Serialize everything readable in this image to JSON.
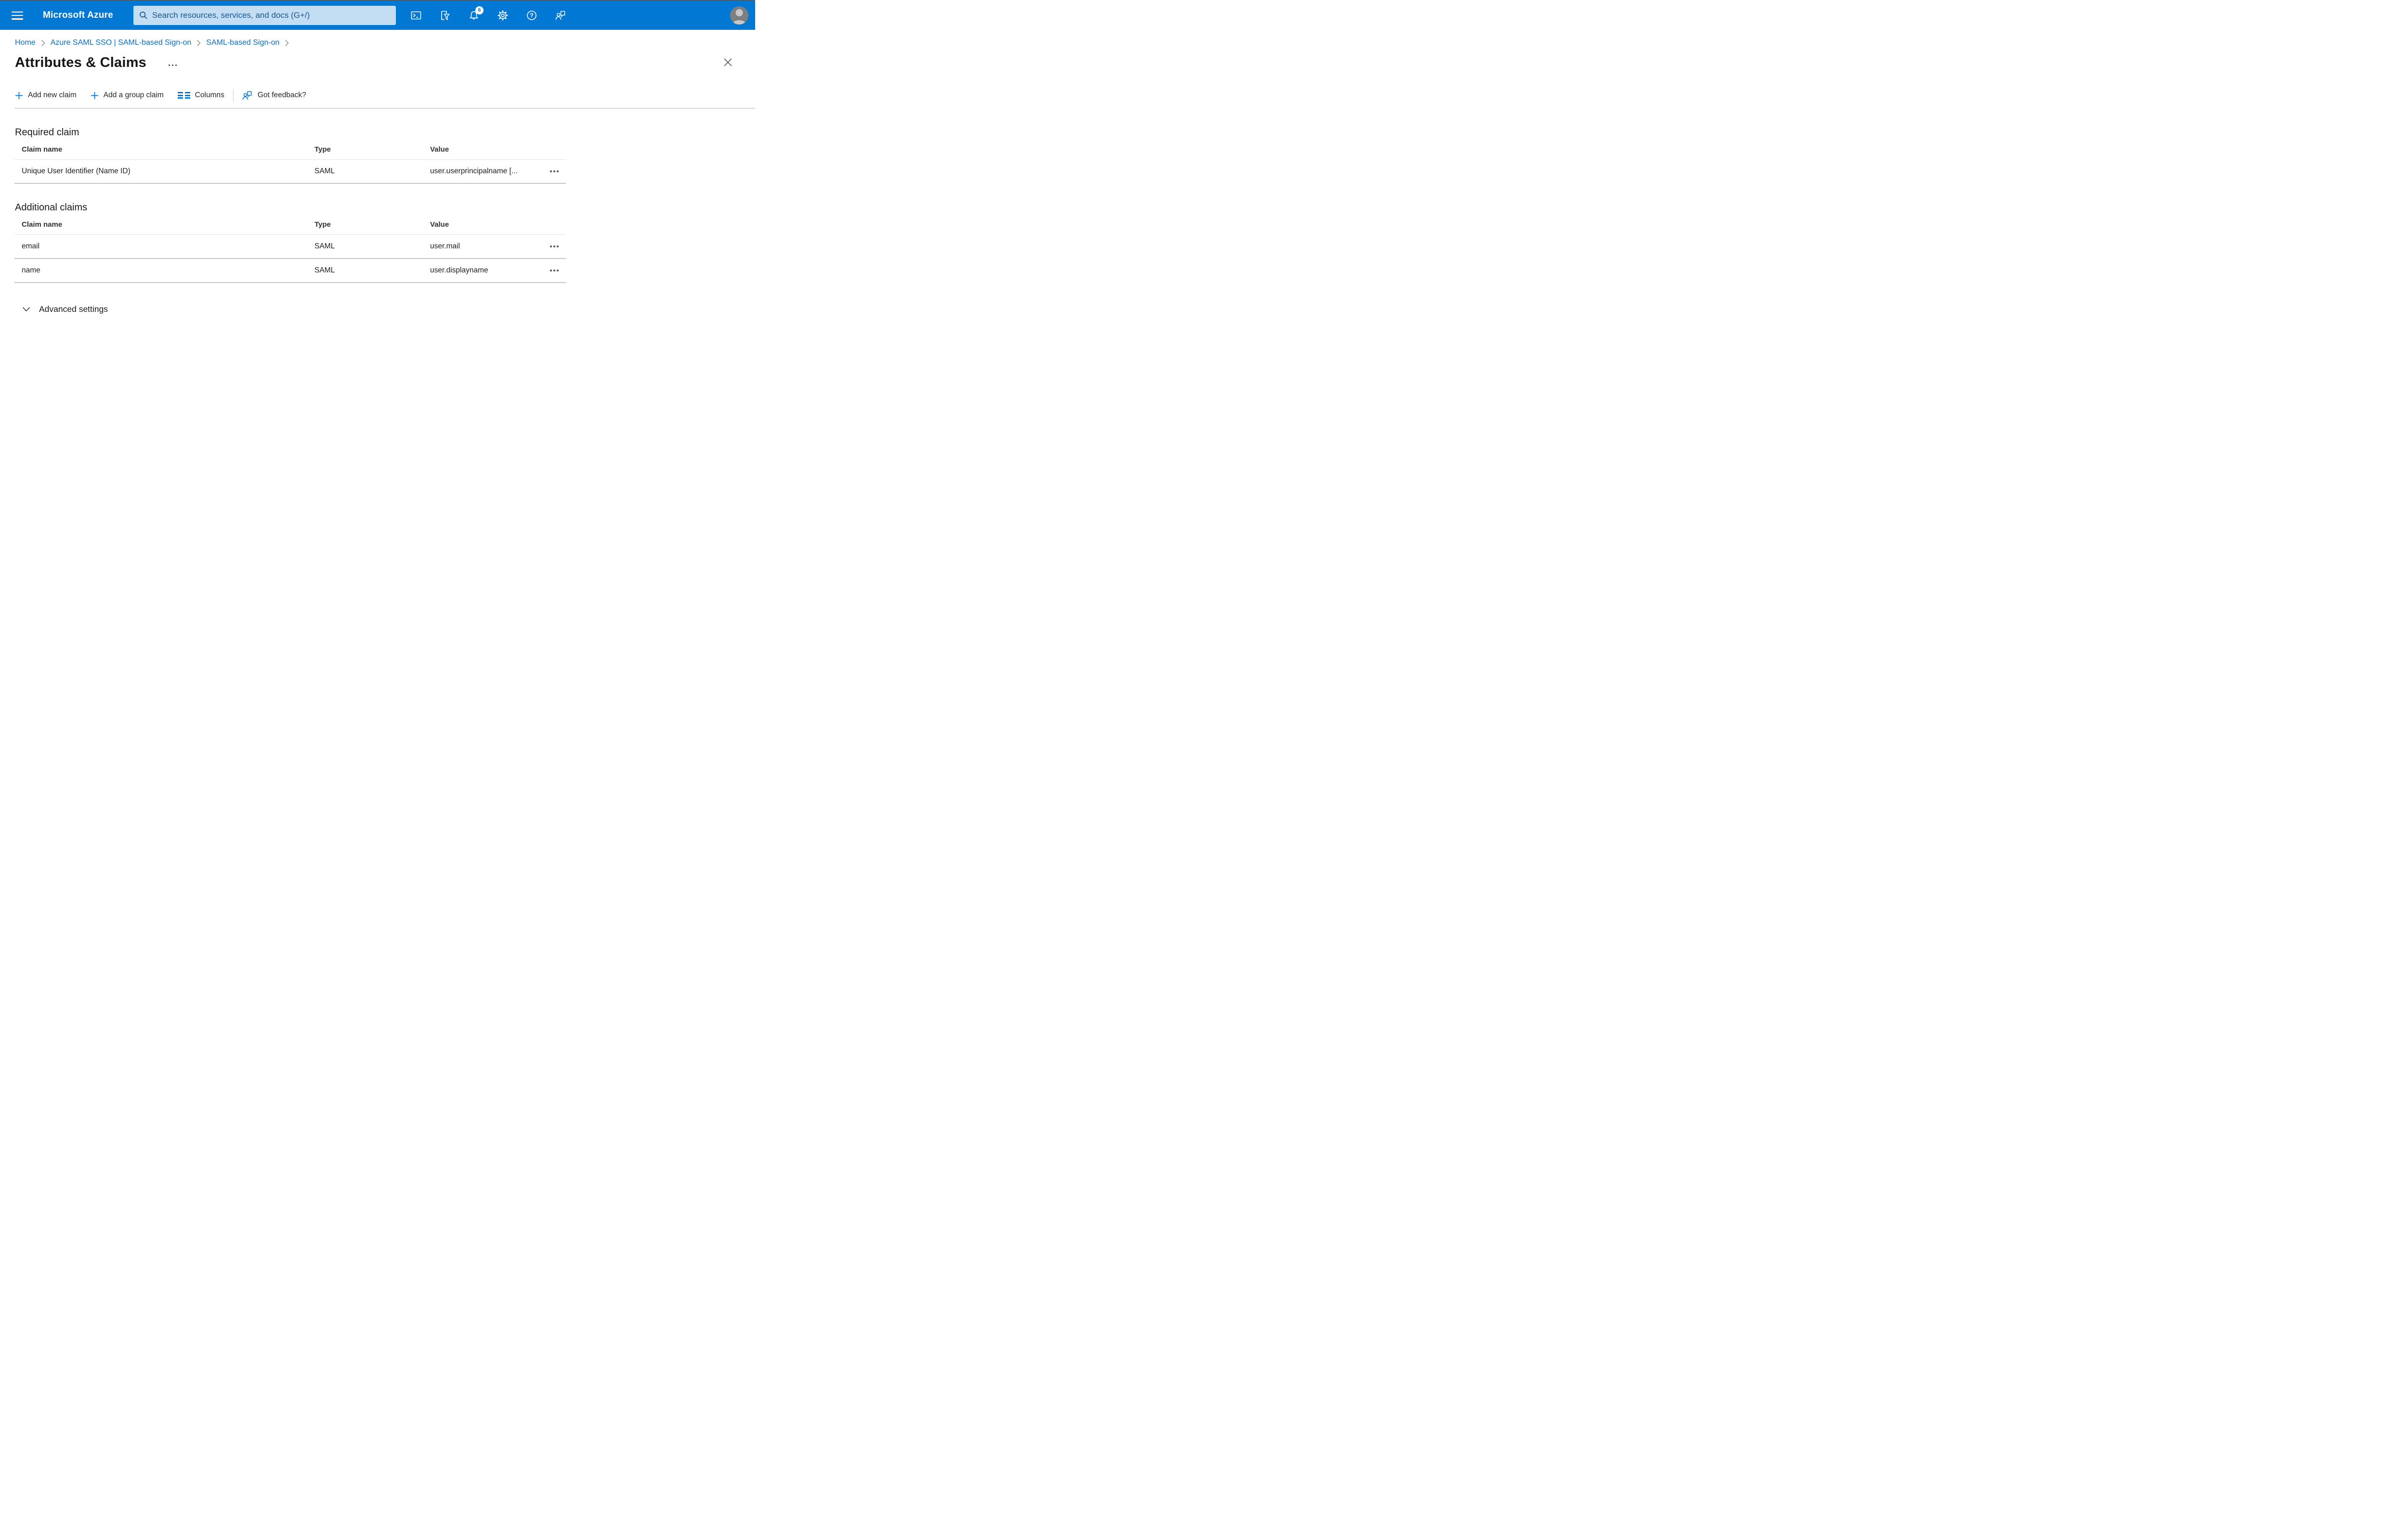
{
  "topbar": {
    "brand": "Microsoft Azure",
    "search_placeholder": "Search resources, services, and docs (G+/)",
    "notification_count": "6"
  },
  "breadcrumb": {
    "items": [
      {
        "label": "Home"
      },
      {
        "label": "Azure SAML SSO | SAML-based Sign-on"
      },
      {
        "label": "SAML-based Sign-on"
      }
    ]
  },
  "page": {
    "title": "Attributes & Claims"
  },
  "toolbar": {
    "add_new_claim": "Add new claim",
    "add_group_claim": "Add a group claim",
    "columns": "Columns",
    "got_feedback": "Got feedback?"
  },
  "required_claim": {
    "heading": "Required claim",
    "headers": [
      "Claim name",
      "Type",
      "Value"
    ],
    "rows": [
      {
        "name": "Unique User Identifier (Name ID)",
        "type": "SAML",
        "value": "user.userprincipalname [..."
      }
    ]
  },
  "additional_claims": {
    "heading": "Additional claims",
    "headers": [
      "Claim name",
      "Type",
      "Value"
    ],
    "rows": [
      {
        "name": "email",
        "type": "SAML",
        "value": "user.mail"
      },
      {
        "name": "name",
        "type": "SAML",
        "value": "user.displayname"
      }
    ]
  },
  "advanced": {
    "label": "Advanced settings"
  },
  "colors": {
    "topbar_bg": "#0078d4",
    "search_bg": "#c3ddf2",
    "search_text": "#19568f",
    "link_blue": "#0b6dc2",
    "accent_blue": "#0078d4",
    "row_border": "#c9c7c5"
  }
}
